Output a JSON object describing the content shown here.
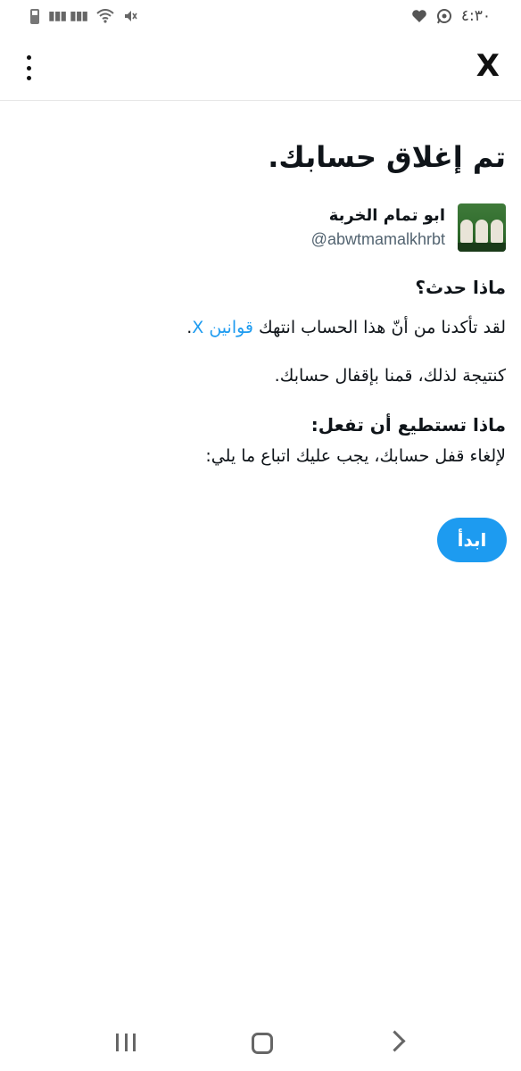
{
  "status_bar": {
    "time": "٤:٣٠"
  },
  "header": {
    "logo": "X"
  },
  "main": {
    "title": "تم إغلاق حسابك.",
    "account": {
      "name": "ابو تمام الخربة",
      "handle": "@abwtmamalkhrbt"
    },
    "what_happened": {
      "heading": "ماذا حدث؟",
      "text_before_link": "لقد تأكدنا من أنّ هذا الحساب انتهك ",
      "link": "قوانين X",
      "text_after_link": ".",
      "consequence": "كنتيجة لذلك، قمنا بإقفال حسابك."
    },
    "what_to_do": {
      "heading": "ماذا تستطيع أن تفعل:",
      "text": "لإلغاء قفل حسابك، يجب عليك اتباع ما يلي:"
    },
    "start_button": "ابدأ"
  },
  "icons": [
    "battery-icon",
    "signal-icon",
    "wifi-icon",
    "mute-icon",
    "whatsapp-icon",
    "heart-icon",
    "more-vert-icon",
    "recent-apps-icon",
    "home-icon",
    "back-icon"
  ],
  "colors": {
    "accent": "#1d9bf0",
    "text": "#0f1419",
    "muted": "#536471"
  }
}
